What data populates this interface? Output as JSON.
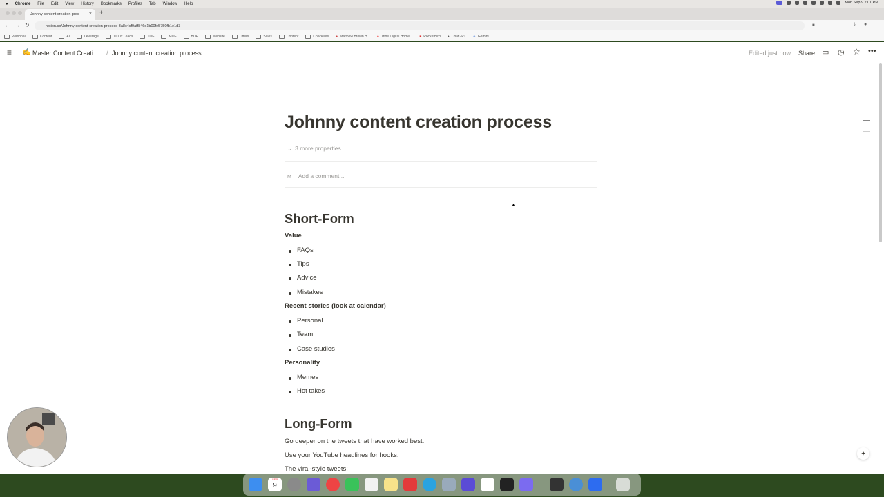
{
  "menubar": {
    "app": "Chrome",
    "items": [
      "File",
      "Edit",
      "View",
      "History",
      "Bookmarks",
      "Profiles",
      "Tab",
      "Window",
      "Help"
    ],
    "clock": "Mon Sep 9  2:01 PM"
  },
  "browser": {
    "tab_title": "Johnny content creation proc",
    "url": "notion.so/Johnny-content-creation-process-3a8c4cf9aff846d1b00fe5750fb1e1d3",
    "bookmarks": [
      "Personal",
      "Content",
      "AI",
      "Leverage",
      "1000x Leads",
      "TOF",
      "MOF",
      "BOF",
      "Website",
      "Offers",
      "Sales",
      "Content",
      "Checklists",
      "Matthew Brown H...",
      "Tribe Digital Home...",
      "RocketBird",
      "ChatGPT",
      "Gemini"
    ]
  },
  "notion": {
    "breadcrumb_parent": "Master Content Creati...",
    "breadcrumb_sep": "/",
    "breadcrumb_current": "Johnny content creation process",
    "edited": "Edited just now",
    "share": "Share",
    "title": "Johnny content creation process",
    "more_properties": "3 more properties",
    "comment_avatar": "M",
    "comment_placeholder": "Add a comment...",
    "short_form": {
      "heading": "Short-Form",
      "groups": [
        {
          "label": "Value",
          "items": [
            "FAQs",
            "Tips",
            "Advice",
            "Mistakes"
          ]
        },
        {
          "label": "Recent stories (look at calendar)",
          "items": [
            "Personal",
            "Team",
            "Case studies"
          ]
        },
        {
          "label": "Personality",
          "items": [
            "Memes",
            "Hot takes"
          ]
        }
      ]
    },
    "long_form": {
      "heading": "Long-Form",
      "paragraphs": [
        "Go deeper on the tweets that have worked best.",
        "Use your YouTube headlines for hooks.",
        "The viral-style tweets:"
      ]
    }
  },
  "dock": {
    "calendar_day": "9",
    "calendar_month": "SEP"
  },
  "colors": {
    "text": "#37352f",
    "muted": "#9b9a97",
    "page_bg": "#ffffff"
  }
}
